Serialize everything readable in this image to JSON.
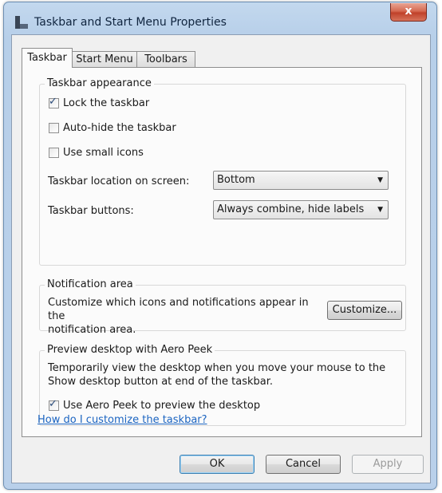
{
  "window": {
    "title": "Taskbar and Start Menu Properties",
    "close_label": "x"
  },
  "tabs": [
    {
      "label": "Taskbar",
      "active": true
    },
    {
      "label": "Start Menu",
      "active": false
    },
    {
      "label": "Toolbars",
      "active": false
    }
  ],
  "taskbar_appearance": {
    "legend": "Taskbar appearance",
    "lock_taskbar": {
      "label": "Lock the taskbar",
      "checked": true
    },
    "auto_hide": {
      "label": "Auto-hide the taskbar",
      "checked": false
    },
    "small_icons": {
      "label": "Use small icons",
      "checked": false
    },
    "location_label": "Taskbar location on screen:",
    "location_value": "Bottom",
    "buttons_label": "Taskbar buttons:",
    "buttons_value": "Always combine, hide labels"
  },
  "notification_area": {
    "legend": "Notification area",
    "description_line1": "Customize which icons and notifications appear in the",
    "description_line2": "notification area.",
    "customize_button": "Customize..."
  },
  "aero_peek": {
    "legend": "Preview desktop with Aero Peek",
    "description_line1": "Temporarily view the desktop when you move your mouse to the",
    "description_line2": "Show desktop button at end of the taskbar.",
    "use_aero_peek": {
      "label": "Use Aero Peek to preview the desktop",
      "checked": true
    }
  },
  "help_link": "How do I customize the taskbar?",
  "footer": {
    "ok": "OK",
    "cancel": "Cancel",
    "apply": "Apply"
  },
  "glyphs": {
    "check": "✓",
    "dropdown_arrow": "▼"
  },
  "colors": {
    "link": "#1b64c1",
    "close_button": "#c7472f",
    "frame": "#b9d0ea"
  }
}
